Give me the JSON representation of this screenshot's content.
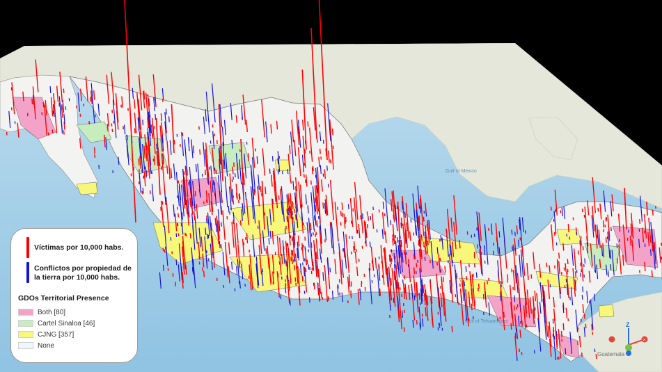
{
  "map": {
    "colors": {
      "sky": "#000000",
      "ocean": "#a9d1e8",
      "land": "#e6e8dc",
      "mexico_land": "#f2f2f2",
      "victims_spike": "#ff0000",
      "land_conflict_spike": "#1414d8",
      "both": "#f4a3c8",
      "cartel_sinaloa": "#c7ecbd",
      "cjng": "#f7f77a",
      "none": "#f0f6ff"
    },
    "basemap_labels": [
      {
        "text": "Gulf of Mexico"
      },
      {
        "text": "Gulf of Tehuantepec"
      },
      {
        "text": "Guatemala"
      }
    ]
  },
  "legend": {
    "victims_label": "Víctimas por 10,000 habs.",
    "conflict_label": "Conflictos por propiedad de la tierra por 10,000 habs.",
    "conflict_line1": "Conflictos por propiedad de",
    "conflict_line2": "la tierra por 10,000 habs.",
    "gdo_title": "GDOs Territorial Presence",
    "items": [
      {
        "label": "Both [80]",
        "color": "#f4a3c8"
      },
      {
        "label": "Cartel Sinaloa [46]",
        "color": "#c7ecbd"
      },
      {
        "label": "CJNG [357]",
        "color": "#f7f77a"
      },
      {
        "label": "None",
        "color": "#f0f6ff"
      }
    ]
  },
  "navigation_axes": {
    "z_label": "Z",
    "x_colors": [
      "#e8433a",
      "#e8433a"
    ],
    "y_color": "#7cc242",
    "z_color": "#2a6fd6"
  }
}
